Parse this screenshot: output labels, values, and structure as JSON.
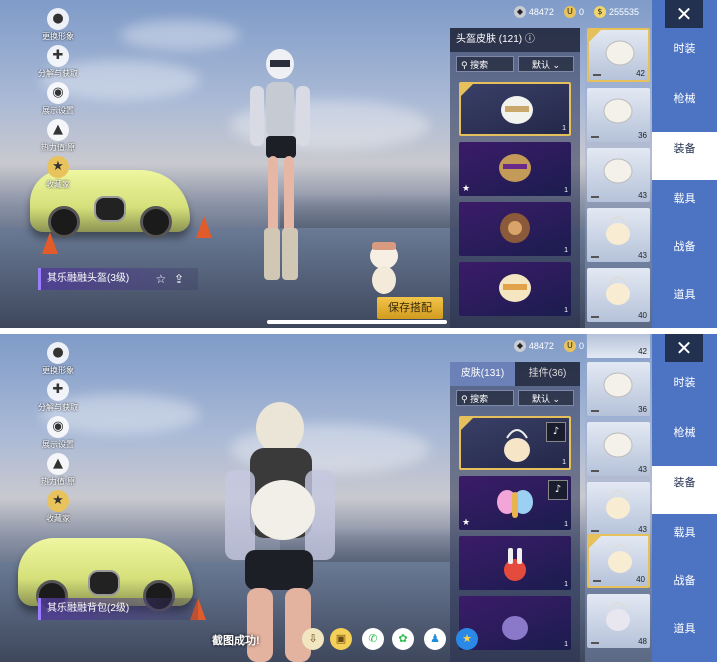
{
  "currency": {
    "silver": "48472",
    "uc": "0",
    "bp": "255535"
  },
  "left_menu": [
    {
      "label": "更换形象",
      "icon": "person-icon"
    },
    {
      "label": "分解与获取",
      "icon": "puzzle-icon"
    },
    {
      "label": "展示设置",
      "icon": "eye-icon"
    },
    {
      "label": "热力值:原",
      "icon": "flame-icon"
    },
    {
      "label": "收藏家",
      "icon": "collector-badge-icon"
    }
  ],
  "categories": [
    {
      "label": "时装"
    },
    {
      "label": "枪械"
    },
    {
      "label": "装备"
    },
    {
      "label": "载具"
    },
    {
      "label": "战备"
    },
    {
      "label": "道具"
    }
  ],
  "top": {
    "item_name": "其乐融融头盔(3级)",
    "list_title": "头盔皮肤 (121)",
    "search_label": "搜索",
    "sort_label": "默认",
    "cards": [
      {
        "count": "1",
        "icon": "white-helmet-icon"
      },
      {
        "count": "1",
        "icon": "gold-helmet-icon",
        "starred": true
      },
      {
        "count": "1",
        "icon": "bronze-helmet-icon"
      },
      {
        "count": "1",
        "icon": "cream-helmet-icon"
      }
    ],
    "equip": [
      {
        "num": "42"
      },
      {
        "num": "36"
      },
      {
        "num": "43"
      },
      {
        "num": "43"
      },
      {
        "num": "40"
      }
    ],
    "save_label": "保存搭配"
  },
  "bottom": {
    "item_name": "其乐融融背包(2级)",
    "tabs": [
      {
        "label": "皮肤(131)"
      },
      {
        "label": "挂件(36)"
      }
    ],
    "search_label": "搜索",
    "sort_label": "默认",
    "cards": [
      {
        "count": "1",
        "icon": "cupcake-backpack-icon"
      },
      {
        "count": "1",
        "icon": "butterfly-backpack-icon",
        "starred": true
      },
      {
        "count": "1",
        "icon": "bunny-backpack-icon"
      },
      {
        "count": "1",
        "icon": "purple-backpack-icon"
      }
    ],
    "equip": [
      {
        "num": "42"
      },
      {
        "num": "36"
      },
      {
        "num": "43"
      },
      {
        "num": "40"
      },
      {
        "num": "48"
      }
    ],
    "toast": "截图成功!",
    "share_icons": [
      "save-icon",
      "gallery-icon",
      "wechat-icon",
      "moments-icon",
      "qq-icon",
      "qzone-icon"
    ]
  },
  "colors": {
    "rail": "#4d74c3",
    "highlight": "#e6c05b",
    "rare_card": "#3c1b69"
  }
}
